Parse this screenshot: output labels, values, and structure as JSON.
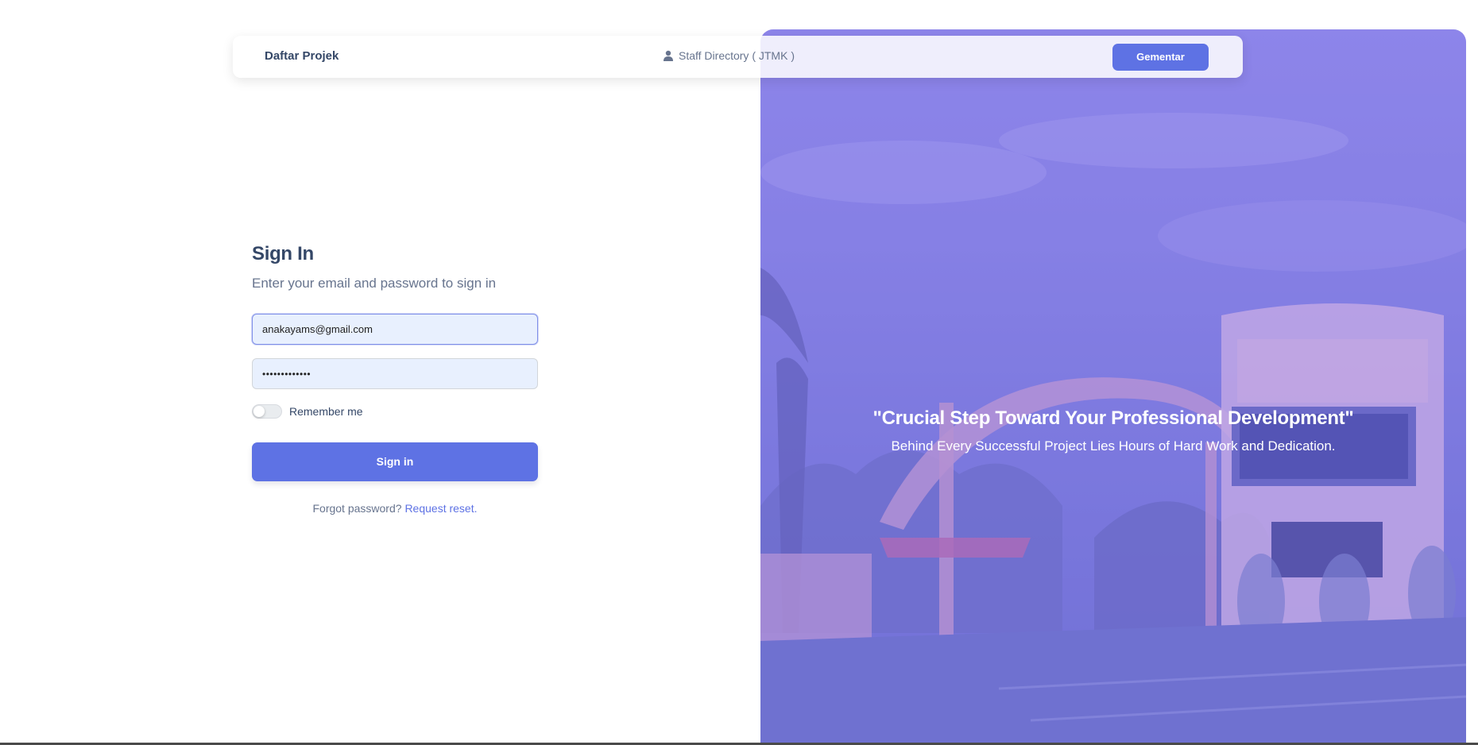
{
  "navbar": {
    "brand": "Daftar Projek",
    "link_label": "Staff Directory ( JTMK )",
    "button_label": "Gementar"
  },
  "signin": {
    "title": "Sign In",
    "subtitle": "Enter your email and password to sign in",
    "email_value": "anakayams@gmail.com",
    "password_value": "•••••••••••••",
    "remember_label": "Remember me",
    "remember_checked": false,
    "button_label": "Sign in",
    "forgot_text": "Forgot password?",
    "reset_link": "Request reset."
  },
  "hero": {
    "quote": "\"Crucial Step Toward Your Professional Development\"",
    "subtitle": "Behind Every Successful Project Lies Hours of Hard Work and Dedication."
  },
  "icons": {
    "user": "user-icon"
  },
  "colors": {
    "primary": "#5e72e4",
    "heading": "#344767",
    "text_muted": "#67748e",
    "input_bg": "#e8f0fe",
    "hero_tint": "#8f8ae6"
  }
}
